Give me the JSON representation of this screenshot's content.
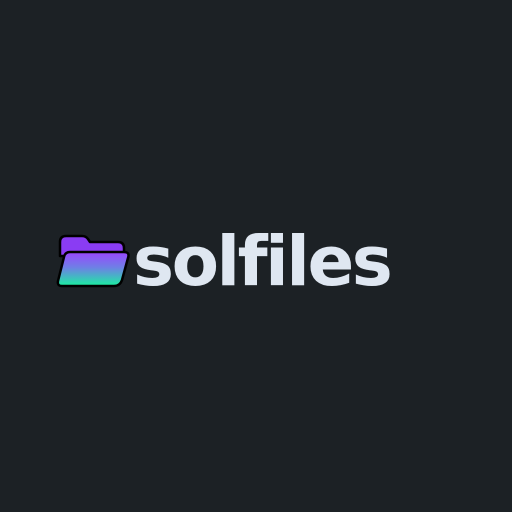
{
  "brand": {
    "name": "solfiles",
    "icon": "folder-icon",
    "colors": {
      "background": "#1c2125",
      "wordmark": "#dfe7f1",
      "icon_gradient_top": "#9a45ff",
      "icon_gradient_bottom": "#19f0a0",
      "icon_back": "#8a3cf3"
    }
  }
}
